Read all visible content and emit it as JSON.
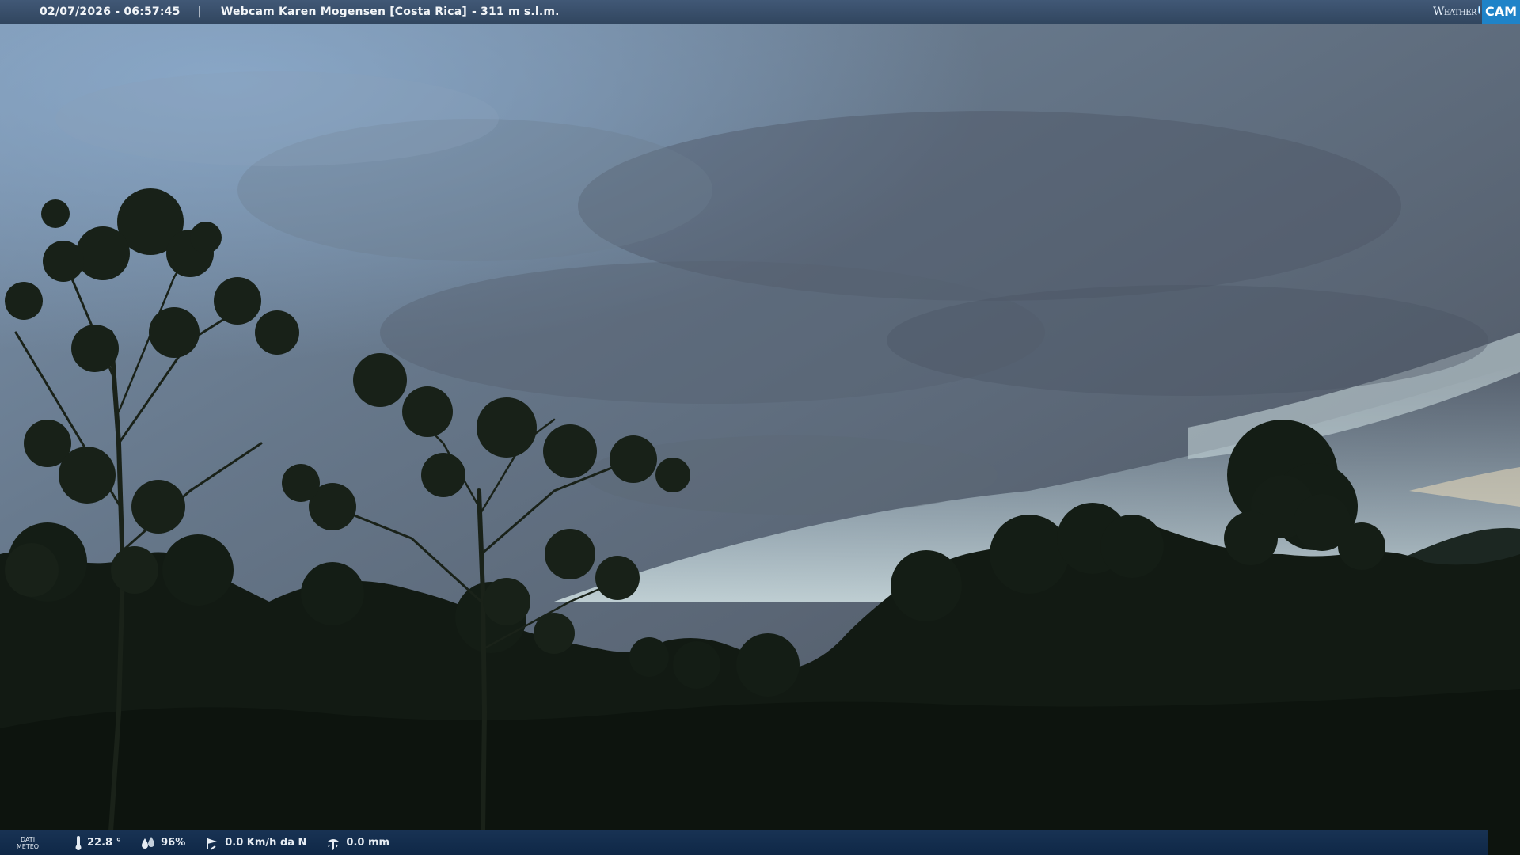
{
  "overlay": {
    "timestamp": "02/07/2026 - 06:57:45",
    "separator": "|",
    "location": "Webcam Karen Mogensen [Costa Rica]",
    "altitude": "- 311 m s.l.m.",
    "logo": {
      "word1": "Weather",
      "word2": "CAM"
    }
  },
  "weather": {
    "label_line1": "DATI",
    "label_line2": "METEO",
    "temperature": "22.8 °",
    "humidity": "96%",
    "wind": "0.0 Km/h da N",
    "rain": "0.0 mm"
  },
  "colors": {
    "top_bar": "#3a506b",
    "bottom_bar": "#14304f",
    "logo_accent": "#1f83c8",
    "sky": "#5f6c7c",
    "canopy": "#101812"
  },
  "icons": [
    "thermometer-icon",
    "humidity-drops-icon",
    "wind-vane-icon",
    "rain-gauge-icon"
  ]
}
